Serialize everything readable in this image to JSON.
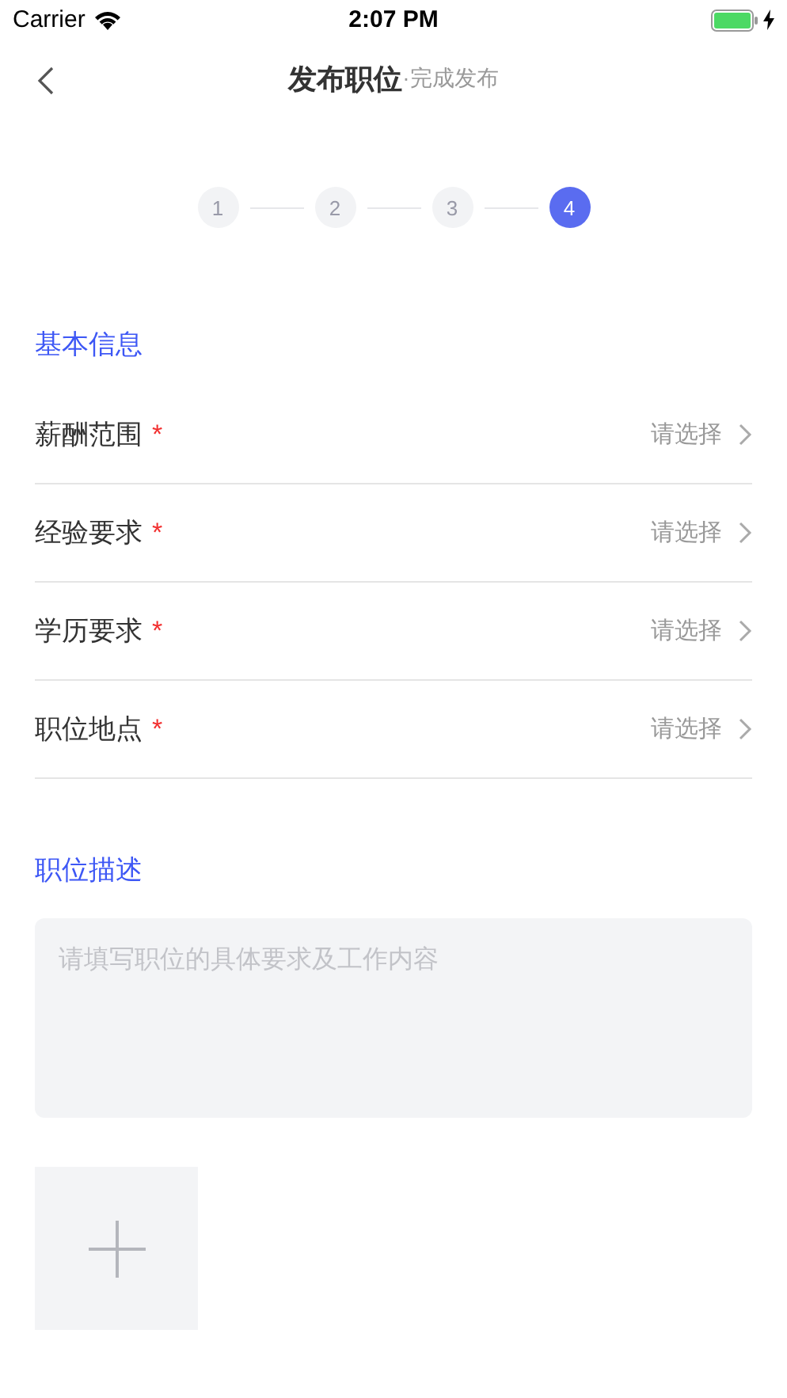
{
  "status_bar": {
    "carrier": "Carrier",
    "time": "2:07 PM"
  },
  "nav": {
    "title": "发布职位",
    "subtitle": "·完成发布"
  },
  "steps": [
    {
      "label": "1",
      "selected": false
    },
    {
      "label": "2",
      "selected": false
    },
    {
      "label": "3",
      "selected": false
    },
    {
      "label": "4",
      "selected": true
    }
  ],
  "basic_section": {
    "title": "基本信息",
    "fields": [
      {
        "label": "薪酬范围",
        "required_mark": "*",
        "value": "请选择"
      },
      {
        "label": "经验要求",
        "required_mark": "*",
        "value": "请选择"
      },
      {
        "label": "学历要求",
        "required_mark": "*",
        "value": "请选择"
      },
      {
        "label": "职位地点",
        "required_mark": "*",
        "value": "请选择"
      }
    ]
  },
  "description_section": {
    "title": "职位描述",
    "placeholder": "请填写职位的具体要求及工作内容"
  }
}
